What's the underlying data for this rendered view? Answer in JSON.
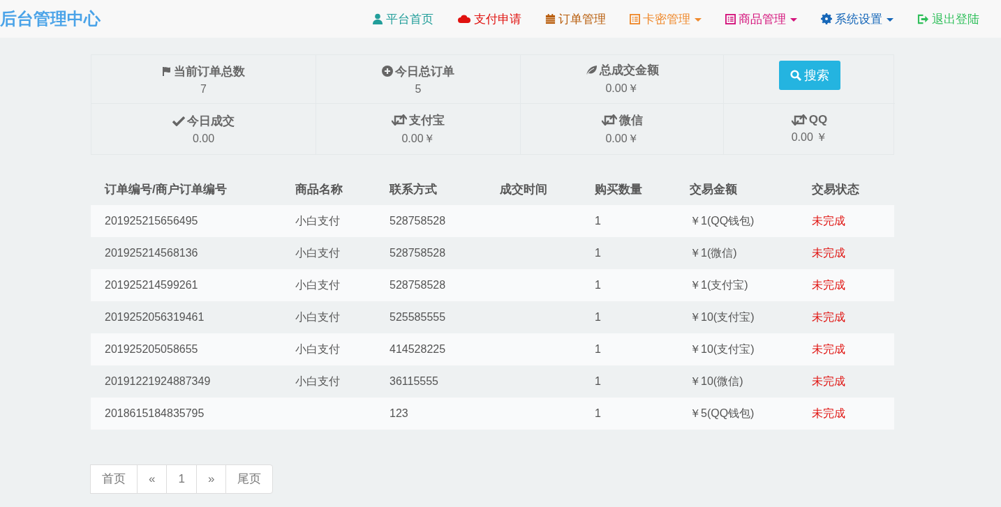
{
  "brand": "后台管理中心",
  "nav": [
    {
      "label": "平台首页",
      "color": "#229e9a",
      "dropdown": false
    },
    {
      "label": "支付申请",
      "color": "#e0120f",
      "dropdown": false
    },
    {
      "label": "订单管理",
      "color": "#b85c0a",
      "dropdown": false
    },
    {
      "label": "卡密管理",
      "color": "#ef8a2e",
      "dropdown": true
    },
    {
      "label": "商品管理",
      "color": "#d4147c",
      "dropdown": true
    },
    {
      "label": "系统设置",
      "color": "#1566b8",
      "dropdown": true
    },
    {
      "label": "退出登陆",
      "color": "#2fbf5a",
      "dropdown": false
    }
  ],
  "stats": [
    {
      "kind": "stat",
      "label": "当前订单总数",
      "value": "7"
    },
    {
      "kind": "stat",
      "label": "今日总订单",
      "value": "5"
    },
    {
      "kind": "stat",
      "label": "总成交金额",
      "value": "0.00￥"
    },
    {
      "kind": "button",
      "label": "搜索"
    },
    {
      "kind": "stat",
      "label": "今日成交",
      "value": "0.00"
    },
    {
      "kind": "stat",
      "label": "支付宝",
      "value": "0.00￥"
    },
    {
      "kind": "stat",
      "label": "微信",
      "value": "0.00￥"
    },
    {
      "kind": "stat",
      "label": "QQ",
      "value": "0.00 ￥"
    }
  ],
  "table": {
    "columns": [
      "订单编号/商户订单编号",
      "商品名称",
      "联系方式",
      "成交时间",
      "购买数量",
      "交易金额",
      "交易状态"
    ],
    "rows": [
      [
        "201925215656495",
        "小白支付",
        "528758528",
        "",
        "1",
        "￥1(QQ钱包)",
        "未完成"
      ],
      [
        "201925214568136",
        "小白支付",
        "528758528",
        "",
        "1",
        "￥1(微信)",
        "未完成"
      ],
      [
        "201925214599261",
        "小白支付",
        "528758528",
        "",
        "1",
        "￥1(支付宝)",
        "未完成"
      ],
      [
        "2019252056319461",
        "小白支付",
        "525585555",
        "",
        "1",
        "￥10(支付宝)",
        "未完成"
      ],
      [
        "201925205058655",
        "小白支付",
        "414528225",
        "",
        "1",
        "￥10(支付宝)",
        "未完成"
      ],
      [
        "20191221924887349",
        "小白支付",
        "36115555",
        "",
        "1",
        "￥10(微信)",
        "未完成"
      ],
      [
        "2018615184835795",
        "",
        "123",
        "",
        "1",
        "￥5(QQ钱包)",
        "未完成"
      ]
    ]
  },
  "pagination": [
    "首页",
    "«",
    "1",
    "»",
    "尾页"
  ]
}
